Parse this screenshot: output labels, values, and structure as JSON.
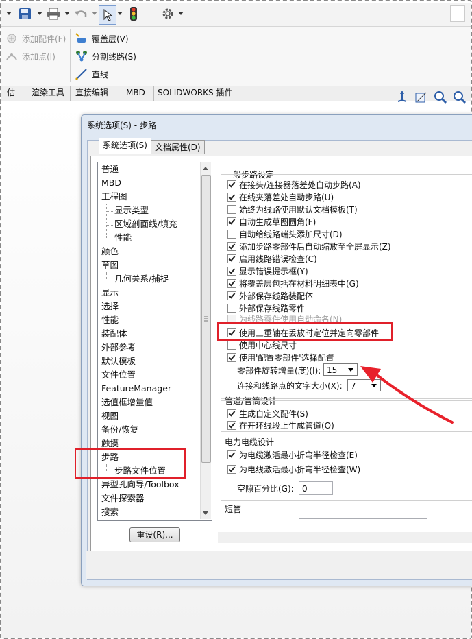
{
  "toolbar": {
    "undo_hint": "",
    "options_hint": ""
  },
  "ribbon": {
    "add_fitting": "添加配件(F)",
    "add_point": "添加点(I)",
    "cover_layer": "覆盖层(V)",
    "split_route": "分割线路(S)",
    "line": "直线"
  },
  "tabs": [
    "估",
    "渲染工具",
    "直接编辑",
    "MBD",
    "SOLIDWORKS 插件"
  ],
  "dialog": {
    "title": "系统选项(S) - 步路",
    "tab_system": "系统选项(S)",
    "tab_doc": "文档属性(D)",
    "reset_label": "重设(R)..."
  },
  "tree": [
    {
      "label": "普通",
      "level": 0
    },
    {
      "label": "MBD",
      "level": 0
    },
    {
      "label": "工程图",
      "level": 0
    },
    {
      "label": "显示类型",
      "level": 1
    },
    {
      "label": "区域剖面线/填充",
      "level": 1
    },
    {
      "label": "性能",
      "level": 1
    },
    {
      "label": "颜色",
      "level": 0
    },
    {
      "label": "草图",
      "level": 0
    },
    {
      "label": "几何关系/捕捉",
      "level": 1
    },
    {
      "label": "显示",
      "level": 0
    },
    {
      "label": "选择",
      "level": 0
    },
    {
      "label": "性能",
      "level": 0
    },
    {
      "label": "装配体",
      "level": 0
    },
    {
      "label": "外部参考",
      "level": 0
    },
    {
      "label": "默认模板",
      "level": 0
    },
    {
      "label": "文件位置",
      "level": 0
    },
    {
      "label": "FeatureManager",
      "level": 0
    },
    {
      "label": "选值框增量值",
      "level": 0
    },
    {
      "label": "视图",
      "level": 0
    },
    {
      "label": "备份/恢复",
      "level": 0
    },
    {
      "label": "触摸",
      "level": 0
    },
    {
      "label": "步路",
      "level": 0
    },
    {
      "label": "步路文件位置",
      "level": 1
    },
    {
      "label": "异型孔向导/Toolbox",
      "level": 0
    },
    {
      "label": "文件探索器",
      "level": 0
    },
    {
      "label": "搜索",
      "level": 0
    }
  ],
  "general": {
    "title": "一般步路设定",
    "options": [
      {
        "label": "在接头/连接器落差处自动步路(A)",
        "checked": true,
        "enabled": true
      },
      {
        "label": "在线夹落差处自动步路(U)",
        "checked": true,
        "enabled": true
      },
      {
        "label": "始终为线路使用默认文档模板(T)",
        "checked": false,
        "enabled": true
      },
      {
        "label": "自动生成草图圆角(F)",
        "checked": true,
        "enabled": true
      },
      {
        "label": "自动给线路端头添加尺寸(D)",
        "checked": false,
        "enabled": true
      },
      {
        "label": "添加步路零部件后自动缩放至全屏显示(Z)",
        "checked": true,
        "enabled": true
      },
      {
        "label": "启用线路错误检查(C)",
        "checked": true,
        "enabled": true
      },
      {
        "label": "显示错误提示框(Y)",
        "checked": true,
        "enabled": true
      },
      {
        "label": "将覆盖层包括在材料明细表中(G)",
        "checked": true,
        "enabled": true
      },
      {
        "label": "外部保存线路装配体",
        "checked": true,
        "enabled": true
      },
      {
        "label": "外部保存线路零件",
        "checked": false,
        "enabled": true
      },
      {
        "label": "为线路零件使用自动命名(N)",
        "checked": false,
        "enabled": false
      },
      {
        "label": "使用三重轴在丢放时定位并定向零部件",
        "checked": true,
        "enabled": true
      },
      {
        "label": "使用中心线尺寸",
        "checked": false,
        "enabled": true
      },
      {
        "label": "使用'配置零部件'选择配置",
        "checked": true,
        "enabled": true
      }
    ],
    "rotation_label": "零部件旋转增量(度)(I):",
    "rotation_value": "15",
    "textsize_label": "连接和线路点的文字大小(X):",
    "textsize_value": "7"
  },
  "pipe": {
    "title": "管道/管筒设计",
    "options": [
      {
        "label": "生成自定义配件(S)",
        "checked": true
      },
      {
        "label": "在开环线段上生成管道(O)",
        "checked": true
      }
    ]
  },
  "cable": {
    "title": "电力电缆设计",
    "options": [
      {
        "label": "为电缆激活最小折弯半径检查(E)",
        "checked": true
      },
      {
        "label": "为电线激活最小折弯半径检查(W)",
        "checked": true
      }
    ],
    "gap_label": "空隙百分比(G):",
    "gap_value": "0"
  },
  "short_pipe": {
    "title": "短管"
  },
  "colors": {
    "highlight": "#e0202a",
    "arrow": "#e8212b"
  }
}
